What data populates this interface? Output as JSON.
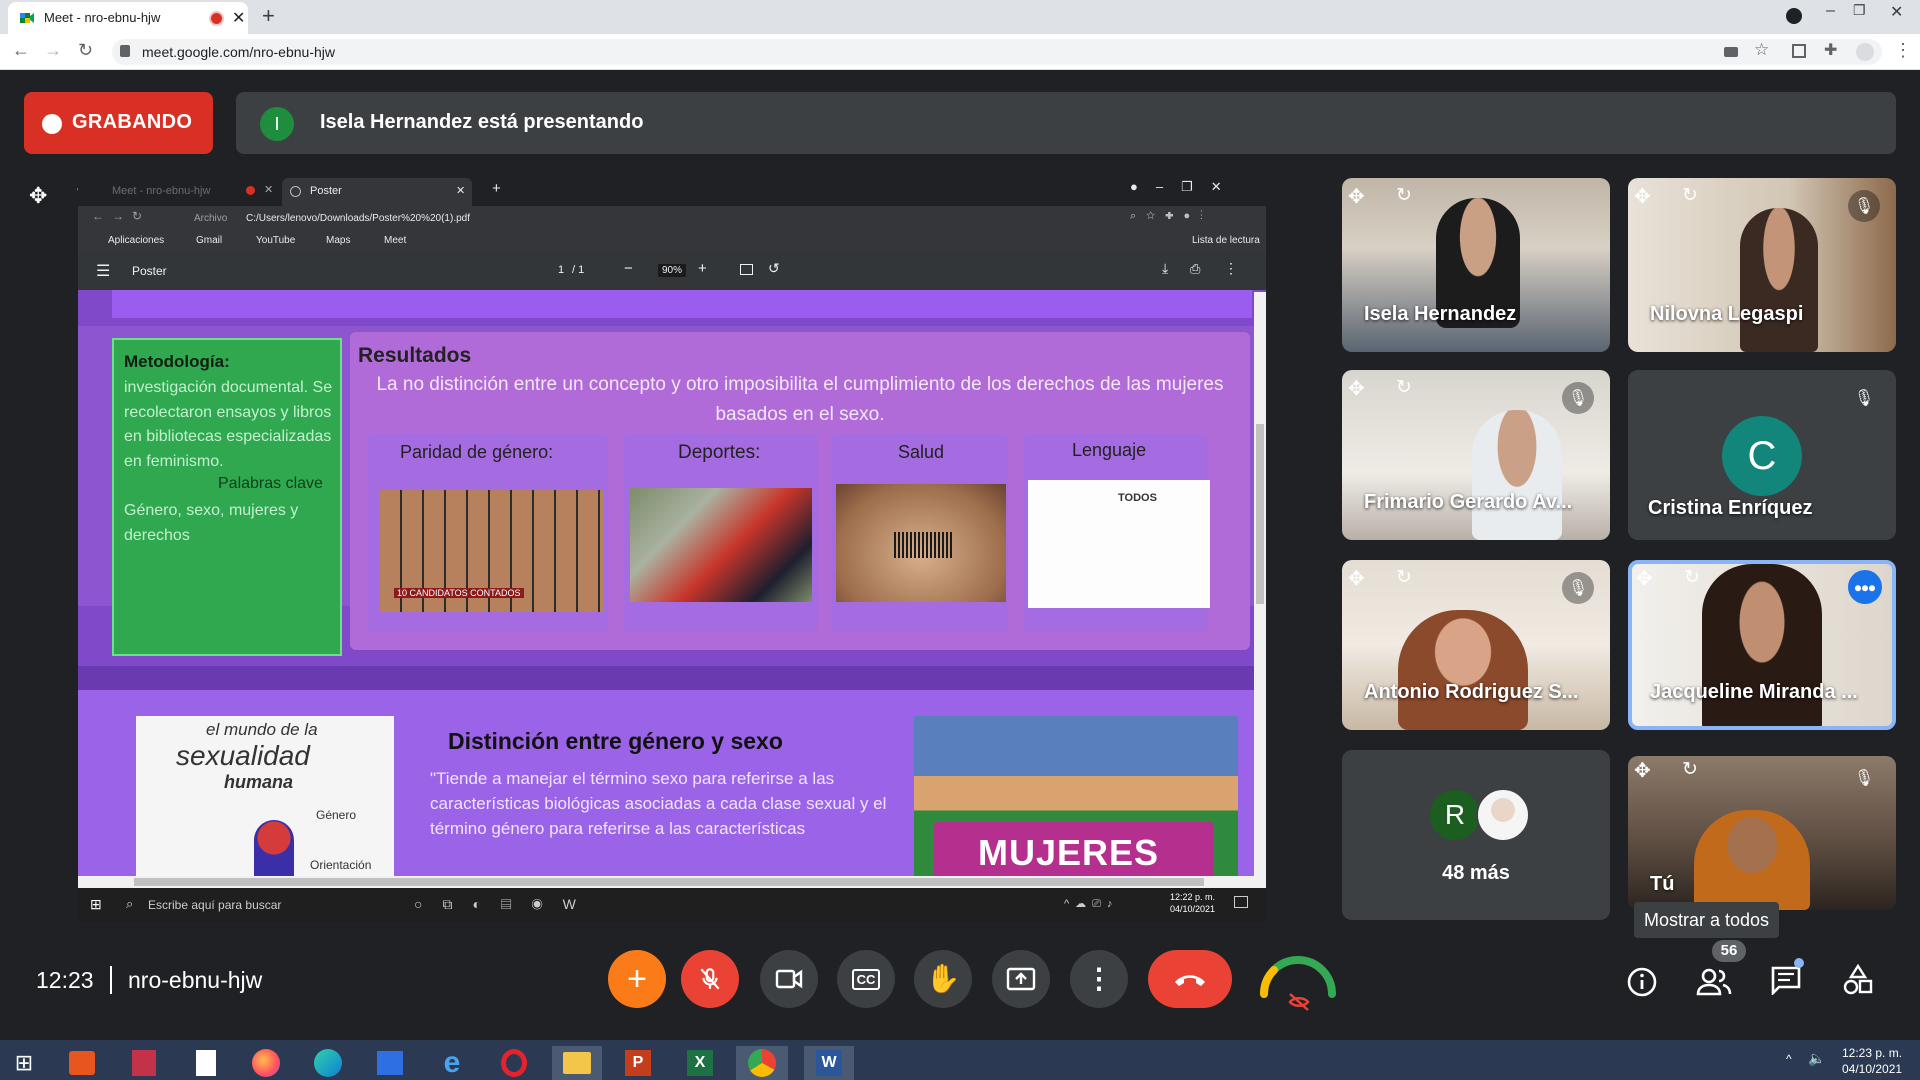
{
  "browser": {
    "tab_title": "Meet - nro-ebnu-hjw",
    "url": "meet.google.com/nro-ebnu-hjw"
  },
  "meet": {
    "recording_label": "GRABANDO",
    "presenter_initial": "I",
    "presenting_text": "Isela Hernandez está presentando",
    "time": "12:23",
    "meeting_code": "nro-ebnu-hjw",
    "people_count": "56",
    "show_all_tooltip": "Mostrar a todos"
  },
  "participants": [
    {
      "name": "Isela Hernandez"
    },
    {
      "name": "Nilovna Legaspi"
    },
    {
      "name": "Frimario Gerardo Av..."
    },
    {
      "name": "Cristina Enríquez",
      "initial": "C"
    },
    {
      "name": "Antonio Rodriguez S..."
    },
    {
      "name": "Jacqueline Miranda ..."
    },
    {
      "name": "48 más",
      "initial": "R"
    },
    {
      "name": "Tú"
    }
  ],
  "shared": {
    "inner_tab1": "Meet - nro-ebnu-hjw",
    "inner_tab2": "Poster",
    "inner_url_prefix": "Archivo",
    "inner_url": "C:/Users/lenovo/Downloads/Poster%20%20(1).pdf",
    "bookmarks": [
      "Aplicaciones",
      "Gmail",
      "YouTube",
      "Maps",
      "Meet"
    ],
    "reading_list": "Lista de lectura",
    "pdf_title": "Poster",
    "page_current": "1",
    "page_total": "/ 1",
    "zoom": "90%",
    "inner_taskbar_search": "Escribe aquí para buscar",
    "inner_time": "12:22 p. m.",
    "inner_date": "04/10/2021"
  },
  "poster": {
    "metodologia_title": "Metodología:",
    "metodologia_text": "investigación documental. Se recolectaron ensayos y libros en bibliotecas especializadas en feminismo.",
    "palabras_clave": "Palabras clave",
    "keywords_text": "Género, sexo, mujeres y derechos",
    "resultados_title": "Resultados",
    "resultados_text": "La no distinción entre un concepto y otro imposibilita el cumplimiento de  los derechos de las mujeres basados en el sexo.",
    "col1": "Paridad de género:",
    "col2": "Deportes:",
    "col3": "Salud",
    "col4": "Lenguaje",
    "col1_caption": "10 CANDIDATOS CONTADOS",
    "col4_caption": "TODOS",
    "book_line1": "el mundo de la",
    "book_line2": "sexualidad",
    "book_line3": "humana",
    "book_label1": "Género",
    "book_label2": "Orientación",
    "distincion_title": "Distinción entre género y sexo",
    "distincion_text": "\"Tiende a manejar el término sexo para referirse a las características biológicas asociadas a cada clase sexual y el término género para referirse a las características",
    "banner": "MUJERES"
  },
  "taskbar": {
    "time": "12:23 p. m.",
    "date": "04/10/2021"
  },
  "colors": {
    "record_red": "#d93025",
    "meet_bg": "#202124",
    "poster_purple": "#9c6fde",
    "poster_green": "#2fa84f",
    "add_orange": "#fa7b17"
  }
}
